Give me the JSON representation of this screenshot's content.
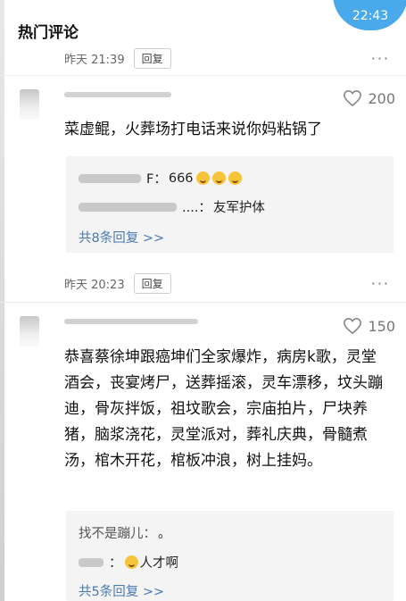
{
  "status": {
    "clock": "22:43"
  },
  "section": {
    "title": "热门评论"
  },
  "comments": [
    {
      "time": "昨天 21:39",
      "reply_label": "回复",
      "likes": "200",
      "text": "菜虚鲲，火葬场打电话来说你妈粘锅了",
      "replies": [
        {
          "name_tail": "F：",
          "text": "666",
          "emojis": [
            "laugh-cry-emoji",
            "laugh-cry-emoji",
            "laugh-cry-emoji"
          ]
        },
        {
          "name_tail": "....：",
          "text": "友军护体"
        }
      ],
      "more": "共8条回复 >>"
    },
    {
      "time": "昨天 20:23",
      "reply_label": "回复",
      "likes": "150",
      "text": "恭喜蔡徐坤跟癌坤们全家爆炸，病房k歌，灵堂酒会，丧宴烤尸，送葬摇滚，灵车漂移，坟头蹦迪，骨灰拌饭，祖坟歌会，宗庙拍片，尸块养猪，脑浆浇花，灵堂派对，葬礼庆典，骨髓煮汤，棺木开花，棺板冲浪，树上挂妈。",
      "replies": [
        {
          "name_tail": "找不是蹦儿：",
          "text": "。"
        },
        {
          "name_tail": "：",
          "text": "人才啊",
          "emojis": [
            "flushed-emoji"
          ]
        }
      ],
      "more": "共5条回复 >>"
    }
  ],
  "more_icon": "···",
  "colors": {
    "accent": "#49a9ea",
    "link": "#4a7ab0"
  }
}
